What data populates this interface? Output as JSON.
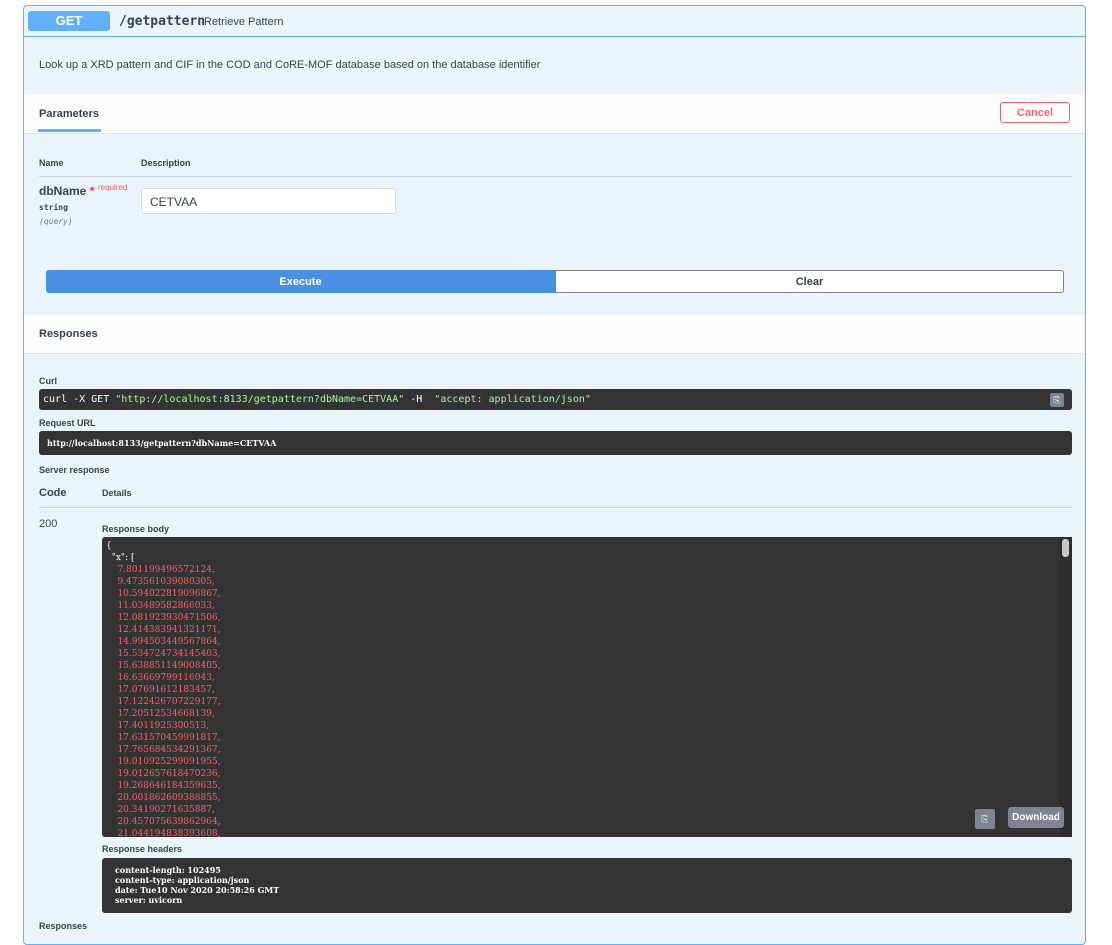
{
  "operation": {
    "method": "GET",
    "path": "/getpattern",
    "summary": "Retrieve Pattern",
    "description": "Look up a XRD pattern and CIF in the COD and CoRE-MOF database based on the database identifier"
  },
  "parameters": {
    "tab_label": "Parameters",
    "cancel_label": "Cancel",
    "col_name": "Name",
    "col_description": "Description",
    "items": [
      {
        "name": "dbName",
        "required_star": "*",
        "required_label": "required",
        "type": "string",
        "in": "(query)",
        "value": "CETVAA"
      }
    ]
  },
  "actions": {
    "execute_label": "Execute",
    "clear_label": "Clear"
  },
  "responses": {
    "title": "Responses",
    "curl_label": "Curl",
    "curl_prefix": "curl -X GET ",
    "curl_url": "\"http://localhost:8133/getpattern?dbName=CETVAA\"",
    "curl_mid": " -H  ",
    "curl_header": "\"accept: application/json\"",
    "request_url_label": "Request URL",
    "request_url": "http://localhost:8133/getpattern?dbName=CETVAA",
    "server_response_label": "Server response",
    "code_header": "Code",
    "details_header": "Details",
    "code": "200",
    "response_body_label": "Response body",
    "body_open": "{",
    "body_key": "  \"x\": [",
    "body_values": [
      "7.801199496572124,",
      "9.473561039080305,",
      "10.594022819096867,",
      "11.03489582866033,",
      "12.081923930471506,",
      "12.414383941321171,",
      "14.994503449567864,",
      "15.534724734145403,",
      "15.638851149008405,",
      "16.63669799116043,",
      "17.07691612183457,",
      "17.122426707229177,",
      "17.20512534668139,",
      "17.4011925300513,",
      "17.631570459991817,",
      "17.765684534291367,",
      "19.010925299091955,",
      "19.012657618470236,",
      "19.268646184359635,",
      "20.001862609388855,",
      "20.34190271635887,",
      "20.457075639862964,",
      "21.044194838393608,"
    ],
    "download_label": "Download",
    "response_headers_label": "Response headers",
    "response_headers": [
      "content-length: 102495",
      "content-type: application/json",
      "date: Tue10 Nov 2020 20:58:26 GMT",
      "server: uvicorn"
    ],
    "footer_label": "Responses"
  },
  "icons": {
    "copy": "clipboard-icon"
  }
}
